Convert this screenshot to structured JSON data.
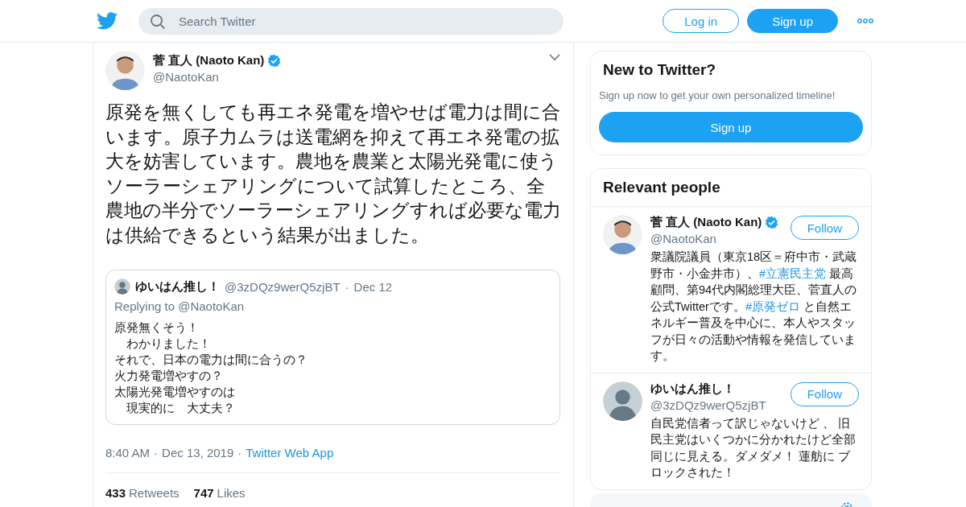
{
  "header": {
    "search": {
      "placeholder": "Search Twitter"
    },
    "login": "Log in",
    "signup": "Sign up"
  },
  "tweet": {
    "name": "菅 直人 (Naoto Kan)",
    "verified": true,
    "handle": "@NaotoKan",
    "text": "原発を無くしても再エネ発電を増やせば電力は間に合います。原子力ムラは送電網を抑えて再エネ発電の拡大を妨害しています。農地を農業と太陽光発電に使うソーラーシェアリングについて試算したところ、全農地の半分でソーラーシェアリングすれば必要な電力は供給できるという結果が出ました。",
    "quote": {
      "name": "ゆいはん推し！",
      "handle": "@3zDQz9werQ5zjBT",
      "separator": "·",
      "date": "Dec 12",
      "replying": "Replying to @NaotoKan",
      "lines": [
        "原発無くそう！",
        "　わかりました！",
        "それで、日本の電力は間に合うの？",
        "火力発電増やすの？",
        "太陽光発電増やすのは",
        "　現実的に　大丈夫？"
      ]
    },
    "time": "8:40 AM",
    "separator_1": "·",
    "date": "Dec 13, 2019",
    "separator_2": "·",
    "source": "Twitter Web App",
    "retweets": "433",
    "retweets_label": "Retweets",
    "likes": "747",
    "likes_label": "Likes"
  },
  "new_to_twitter": {
    "title": "New to Twitter?",
    "text": "Sign up now to get your own personalized timeline!",
    "button": "Sign up"
  },
  "relevant_people": {
    "title": "Relevant people",
    "people": [
      {
        "name": "菅 直人 (Naoto Kan)",
        "verified": true,
        "handle": "@NaotoKan",
        "follow": "Follow",
        "bio": [
          {
            "kind": "text",
            "text": "衆議院議員（東京18区＝府中市・武蔵野市・小金井市）、"
          },
          {
            "kind": "hashtag",
            "text": "#立憲民主党"
          },
          {
            "kind": "text",
            "text": " 最高顧問、第94代内閣総理大臣、菅直人の公式Twitterです。"
          },
          {
            "kind": "hashtag",
            "text": "#原発ゼロ"
          },
          {
            "kind": "text",
            "text": " と自然エネルギー普及を中心に、本人やスタッフが日々の活動や情報を発信しています。"
          }
        ]
      },
      {
        "name": "ゆいはん推し！",
        "verified": false,
        "handle": "@3zDQz9werQ5zjBT",
        "kind": "default",
        "follow": "Follow",
        "bio": [
          {
            "kind": "text",
            "text": "自民党信者って訳じゃないけど 、 旧民主党はいくつかに分かれたけど全部同じに見える。ダメダメ！ 蓮舫に ブロックされた！"
          }
        ]
      }
    ]
  }
}
